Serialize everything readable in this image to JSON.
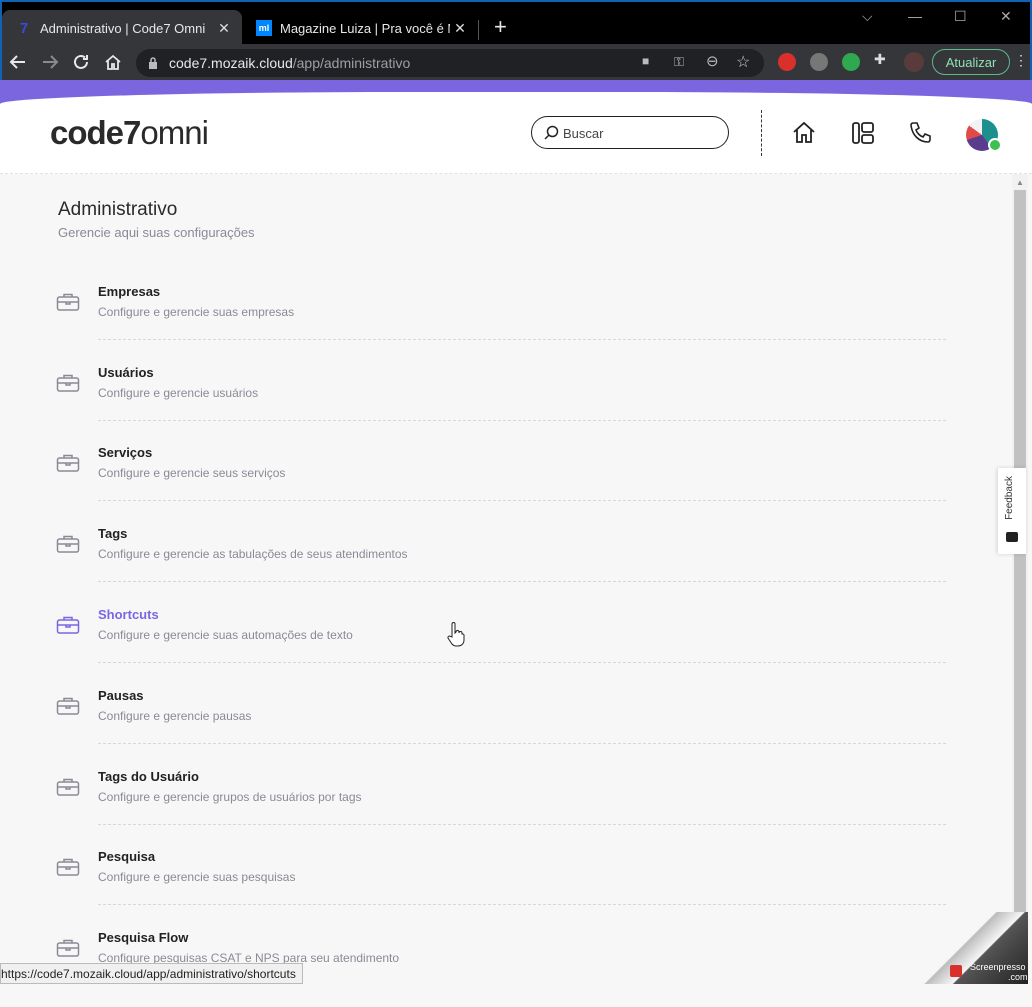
{
  "browser": {
    "tabs": [
      {
        "title": "Administrativo | Code7 Omni",
        "favicon": "7",
        "active": true
      },
      {
        "title": "Magazine Luiza | Pra você é Mag",
        "favicon": "ml",
        "active": false
      }
    ],
    "new_tab": "+",
    "url": {
      "host": "code7.mozaik.cloud",
      "path": "/app/administrativo"
    },
    "update_label": "Atualizar"
  },
  "header": {
    "logo": {
      "bold": "code7",
      "light": "omni"
    },
    "search_placeholder": "Buscar"
  },
  "page": {
    "title": "Administrativo",
    "subtitle": "Gerencie aqui suas configurações",
    "items": [
      {
        "name": "Empresas",
        "desc": "Configure e gerencie suas empresas"
      },
      {
        "name": "Usuários",
        "desc": "Configure e gerencie usuários"
      },
      {
        "name": "Serviços",
        "desc": "Configure e gerencie seus serviços"
      },
      {
        "name": "Tags",
        "desc": "Configure e gerencie as tabulações de seus atendimentos"
      },
      {
        "name": "Shortcuts",
        "desc": "Configure e gerencie suas automações de texto"
      },
      {
        "name": "Pausas",
        "desc": "Configure e gerencie pausas"
      },
      {
        "name": "Tags do Usuário",
        "desc": "Configure e gerencie grupos de usuários por tags"
      },
      {
        "name": "Pesquisa",
        "desc": "Configure e gerencie suas pesquisas"
      },
      {
        "name": "Pesquisa Flow",
        "desc": "Configure pesquisas CSAT e NPS para seu atendimento"
      }
    ]
  },
  "feedback_label": "Feedback",
  "status_url": "https://code7.mozaik.cloud/app/administrativo/shortcuts",
  "watermark": {
    "line1": "Screenpresso",
    "line2": ".com"
  },
  "colors": {
    "accent": "#7b66e0",
    "online": "#3fbe52"
  }
}
